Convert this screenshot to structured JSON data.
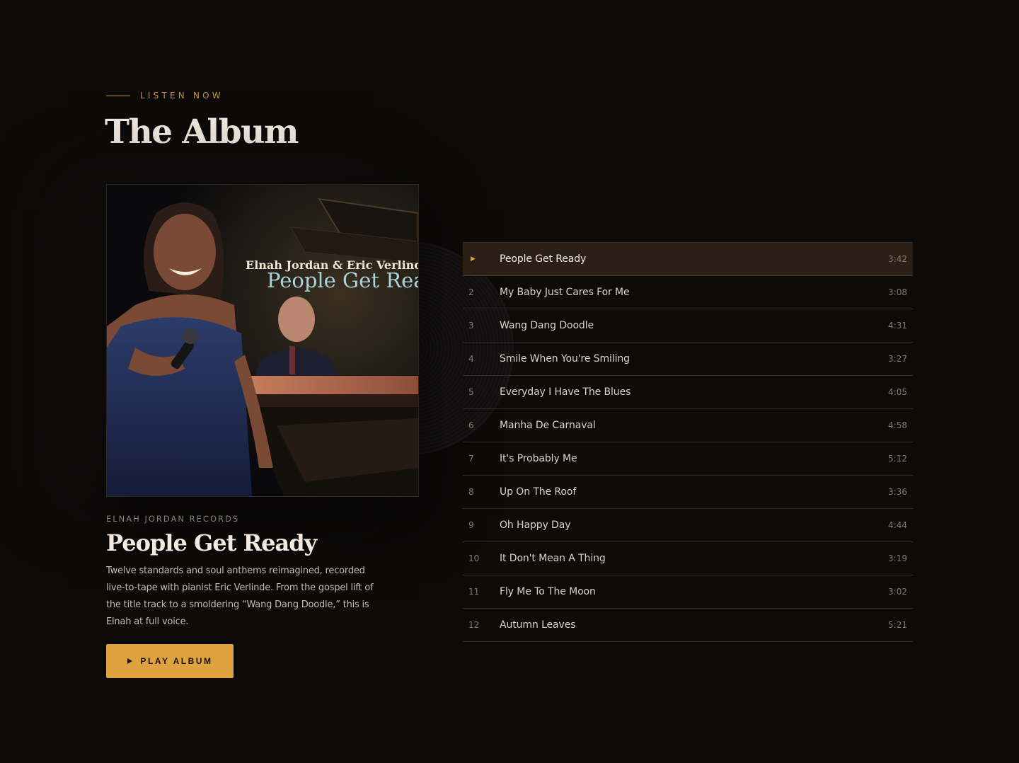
{
  "section": {
    "eyebrow": "LISTEN NOW",
    "title": "The Album"
  },
  "cover": {
    "artists": "Elnah Jordan & Eric Verlinde",
    "title": "People Get Rea"
  },
  "album": {
    "label": "ELNAH JORDAN RECORDS",
    "title": "People Get Ready",
    "description": "Twelve standards and soul anthems reimagined, recorded live-to-tape with pianist Eric Verlinde. From the gospel lift of the title track to a smoldering “Wang Dang Doodle,” this is Elnah at full voice.",
    "play_label": "PLAY ALBUM"
  },
  "colors": {
    "accent": "#e0a23e",
    "background": "#0d0b0a",
    "active_row": "#2a2015"
  },
  "tracks": [
    {
      "num": "▶",
      "title": "People Get Ready",
      "duration": "3:42",
      "active": true
    },
    {
      "num": "2",
      "title": "My Baby Just Cares For Me",
      "duration": "3:08"
    },
    {
      "num": "3",
      "title": "Wang Dang Doodle",
      "duration": "4:31"
    },
    {
      "num": "4",
      "title": "Smile When You're Smiling",
      "duration": "3:27"
    },
    {
      "num": "5",
      "title": "Everyday I Have The Blues",
      "duration": "4:05"
    },
    {
      "num": "6",
      "title": "Manha De Carnaval",
      "duration": "4:58"
    },
    {
      "num": "7",
      "title": "It's Probably Me",
      "duration": "5:12"
    },
    {
      "num": "8",
      "title": "Up On The Roof",
      "duration": "3:36"
    },
    {
      "num": "9",
      "title": "Oh Happy Day",
      "duration": "4:44"
    },
    {
      "num": "10",
      "title": "It Don't Mean A Thing",
      "duration": "3:19"
    },
    {
      "num": "11",
      "title": "Fly Me To The Moon",
      "duration": "3:02"
    },
    {
      "num": "12",
      "title": "Autumn Leaves",
      "duration": "5:21"
    }
  ]
}
